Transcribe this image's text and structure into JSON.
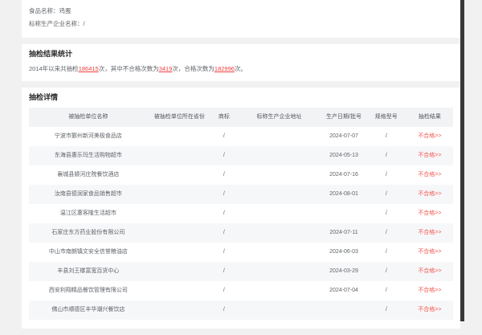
{
  "colors": {
    "page_bg": "#f1f1f2",
    "card_bg": "#ffffff",
    "header_row_bg": "#f2f3f5",
    "stripe_row_bg": "#f6f7f9",
    "link_red": "#f03e3e",
    "result_red": "#f4564e",
    "text_gray": "#5f6368",
    "title_dark": "#2b2b2b",
    "scrollbar_dark": "#383838"
  },
  "info": {
    "food_label": "食品名称：",
    "food_value": "鸡蛋",
    "producer_label": "标称生产企业名称：",
    "producer_value": "/"
  },
  "stats": {
    "title": "抽检结果统计",
    "prefix": "2014年以来共抽检",
    "total": "186415",
    "unit1": "次，其中不合格次数为",
    "failed": "3419",
    "unit2": "次，合格次数为",
    "passed": "182996",
    "suffix": "次。"
  },
  "details": {
    "title": "抽检详情",
    "columns": [
      "被抽检单位名称",
      "被抽检单位所在省份",
      "商标",
      "标称生产企业地址",
      "生产日期/批号",
      "规格型号",
      "抽检结果"
    ],
    "row_keys": [
      "name",
      "province",
      "brand",
      "address",
      "date",
      "spec",
      "result"
    ],
    "rows": [
      {
        "name": "宁波市鄞州新河美极食品店",
        "province": "",
        "brand": "/",
        "address": "",
        "date": "2024-07-07",
        "spec": "/",
        "result": "不合格>>"
      },
      {
        "name": "东海县惠乐玛生活购物超市",
        "province": "",
        "brand": "/",
        "address": "",
        "date": "2024-05-13",
        "spec": "/",
        "result": "不合格>>"
      },
      {
        "name": "襄城县颍河庄院餐饮酒店",
        "province": "",
        "brand": "/",
        "address": "",
        "date": "2024-07-16",
        "spec": "/",
        "result": "不合格>>"
      },
      {
        "name": "汝南县德润家食品销售超市",
        "province": "",
        "brand": "/",
        "address": "",
        "date": "2024-08-01",
        "spec": "/",
        "result": "不合格>>"
      },
      {
        "name": "温江区惠客隆生活超市",
        "province": "",
        "brand": "/",
        "address": "",
        "date": "",
        "spec": "/",
        "result": "不合格>>"
      },
      {
        "name": "石家庄东方药业股份有限公司",
        "province": "",
        "brand": "/",
        "address": "",
        "date": "2024-07-11",
        "spec": "/",
        "result": "不合格>>"
      },
      {
        "name": "中山市南朗镇文安全信誉粮油店",
        "province": "",
        "brand": "/",
        "address": "",
        "date": "2024-06-03",
        "spec": "/",
        "result": "不合格>>"
      },
      {
        "name": "丰县刘王楼富宽百货中心",
        "province": "",
        "brand": "/",
        "address": "",
        "date": "2024-03-29",
        "spec": "/",
        "result": "不合格>>"
      },
      {
        "name": "西安利翔精品餐饮管理有限公司",
        "province": "",
        "brand": "/",
        "address": "",
        "date": "2024-07-04",
        "spec": "/",
        "result": "不合格>>"
      },
      {
        "name": "佛山市顺德区丰华潮兴餐饮店",
        "province": "",
        "brand": "/",
        "address": "",
        "date": "",
        "spec": "/",
        "result": "不合格>>"
      }
    ]
  }
}
